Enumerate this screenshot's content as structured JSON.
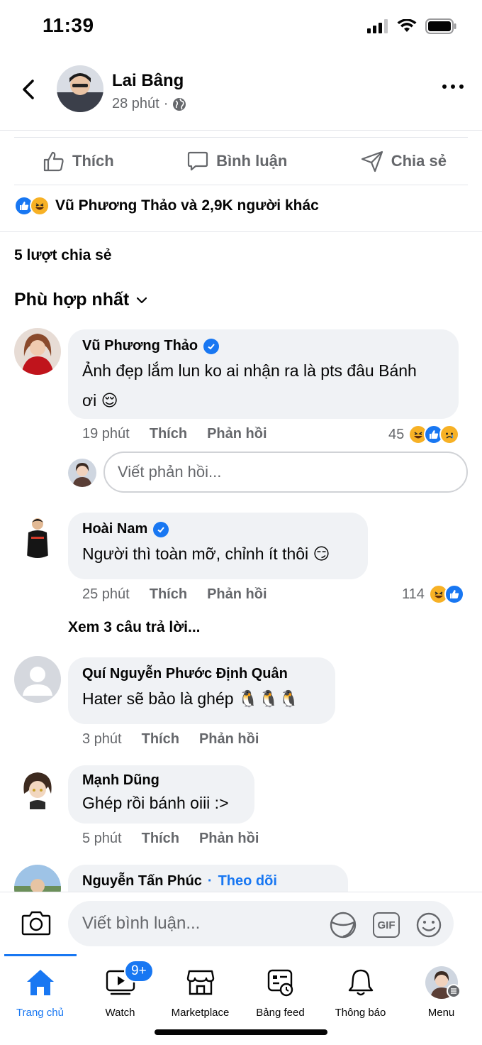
{
  "status": {
    "time": "11:39"
  },
  "post": {
    "author": "Lai Bâng",
    "time": "28 phút",
    "separator": "·"
  },
  "actions": {
    "like": "Thích",
    "comment": "Bình luận",
    "share": "Chia sẻ"
  },
  "reactions_summary": "Vũ Phương Thảo và 2,9K người khác",
  "shares": "5 lượt chia sẻ",
  "sort": "Phù hợp nhất",
  "comments": [
    {
      "name": "Vũ Phương Thảo",
      "verified": true,
      "text_line1": "Ảnh đẹp lắm lun ko ai nhận ra là pts đâu Bánh",
      "text_line2": "ơi 😌",
      "time": "19 phút",
      "like": "Thích",
      "reply": "Phản hồi",
      "reaction_count": "45"
    },
    {
      "name": "Hoài Nam",
      "verified": true,
      "text": "Người thì toàn mỡ, chỉnh ít thôi 😏",
      "time": "25 phút",
      "like": "Thích",
      "reply": "Phản hồi",
      "reaction_count": "114"
    },
    {
      "name": "Quí Nguyễn Phước Định Quân",
      "text": "Hater sẽ bảo là ghép 🐧🐧🐧",
      "time": "3 phút",
      "like": "Thích",
      "reply": "Phản hồi"
    },
    {
      "name": "Mạnh Dũng",
      "text": "Ghép rồi bánh oiii :>",
      "time": "5 phút",
      "like": "Thích",
      "reply": "Phản hồi"
    },
    {
      "name": "Nguyễn Tấn Phúc",
      "follow": "Theo dõi"
    }
  ],
  "reply_placeholder": "Viết phản hồi...",
  "view_replies": "Xem 3 câu trả lời...",
  "compose": {
    "placeholder": "Viết bình luận...",
    "gif": "GIF"
  },
  "tabs": [
    {
      "label": "Trang chủ",
      "icon": "home-icon"
    },
    {
      "label": "Watch",
      "icon": "watch-icon",
      "badge": "9+"
    },
    {
      "label": "Marketplace",
      "icon": "marketplace-icon"
    },
    {
      "label": "Bảng feed",
      "icon": "feed-icon"
    },
    {
      "label": "Thông báo",
      "icon": "bell-icon"
    },
    {
      "label": "Menu",
      "icon": "menu-avatar"
    }
  ],
  "colors": {
    "brand": "#1877f2",
    "bubble": "#f0f2f5",
    "muted": "#65676b"
  }
}
